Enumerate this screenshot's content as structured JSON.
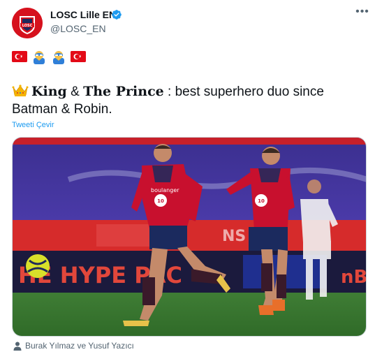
{
  "tweet": {
    "display_name": "LOSC Lille EN",
    "handle": "@LOSC_EN",
    "verified": true,
    "more_icon": "ellipsis-icon",
    "emoji_line": [
      "turkey-flag",
      "superhero-emoji",
      "superhero-emoji",
      "turkey-flag"
    ],
    "text": {
      "crown_icon": "crown-icon",
      "king": "King",
      "amp": " & ",
      "prince": "The Prince",
      "rest": " : best superhero duo since Batman & Robin."
    },
    "translate_label": "Tweeti Çevir",
    "media": {
      "description_icon": "photo",
      "banner_text_left": "HE HYPE PAC",
      "jersey_sponsor": "boulanger"
    },
    "tagged_label": "Burak Yılmaz ve Yusuf Yazıcı",
    "tagged_icon": "person-icon"
  },
  "colors": {
    "accent": "#1d9bf0",
    "lille_red": "#d6111d",
    "muted_text": "#536471",
    "turkey_red": "#e30a17"
  }
}
